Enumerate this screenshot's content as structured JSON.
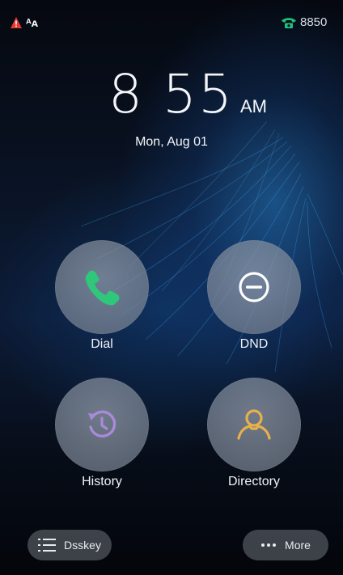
{
  "statusbar": {
    "warning_icon": "warning-triangle-icon",
    "font_indicator": "ᴬᴀ",
    "phone_icon": "phone-handset-icon",
    "extension": "8850",
    "colors": {
      "warning": "#e53935",
      "phone": "#22c17a"
    }
  },
  "clock": {
    "time": "8 55",
    "ampm": "AM",
    "date": "Mon, Aug 01"
  },
  "tiles": [
    {
      "label": "Dial",
      "icon": "phone-icon",
      "color": "#2fc87a"
    },
    {
      "label": "DND",
      "icon": "do-not-disturb-icon",
      "color": "#ffffff"
    },
    {
      "label": "History",
      "icon": "history-icon",
      "color": "#a98ad8"
    },
    {
      "label": "Directory",
      "icon": "contact-person-icon",
      "color": "#e8b04d"
    }
  ],
  "bottom": {
    "dsskey": {
      "label": "Dsskey",
      "icon": "list-icon"
    },
    "more": {
      "label": "More",
      "icon": "more-dots-icon"
    }
  }
}
